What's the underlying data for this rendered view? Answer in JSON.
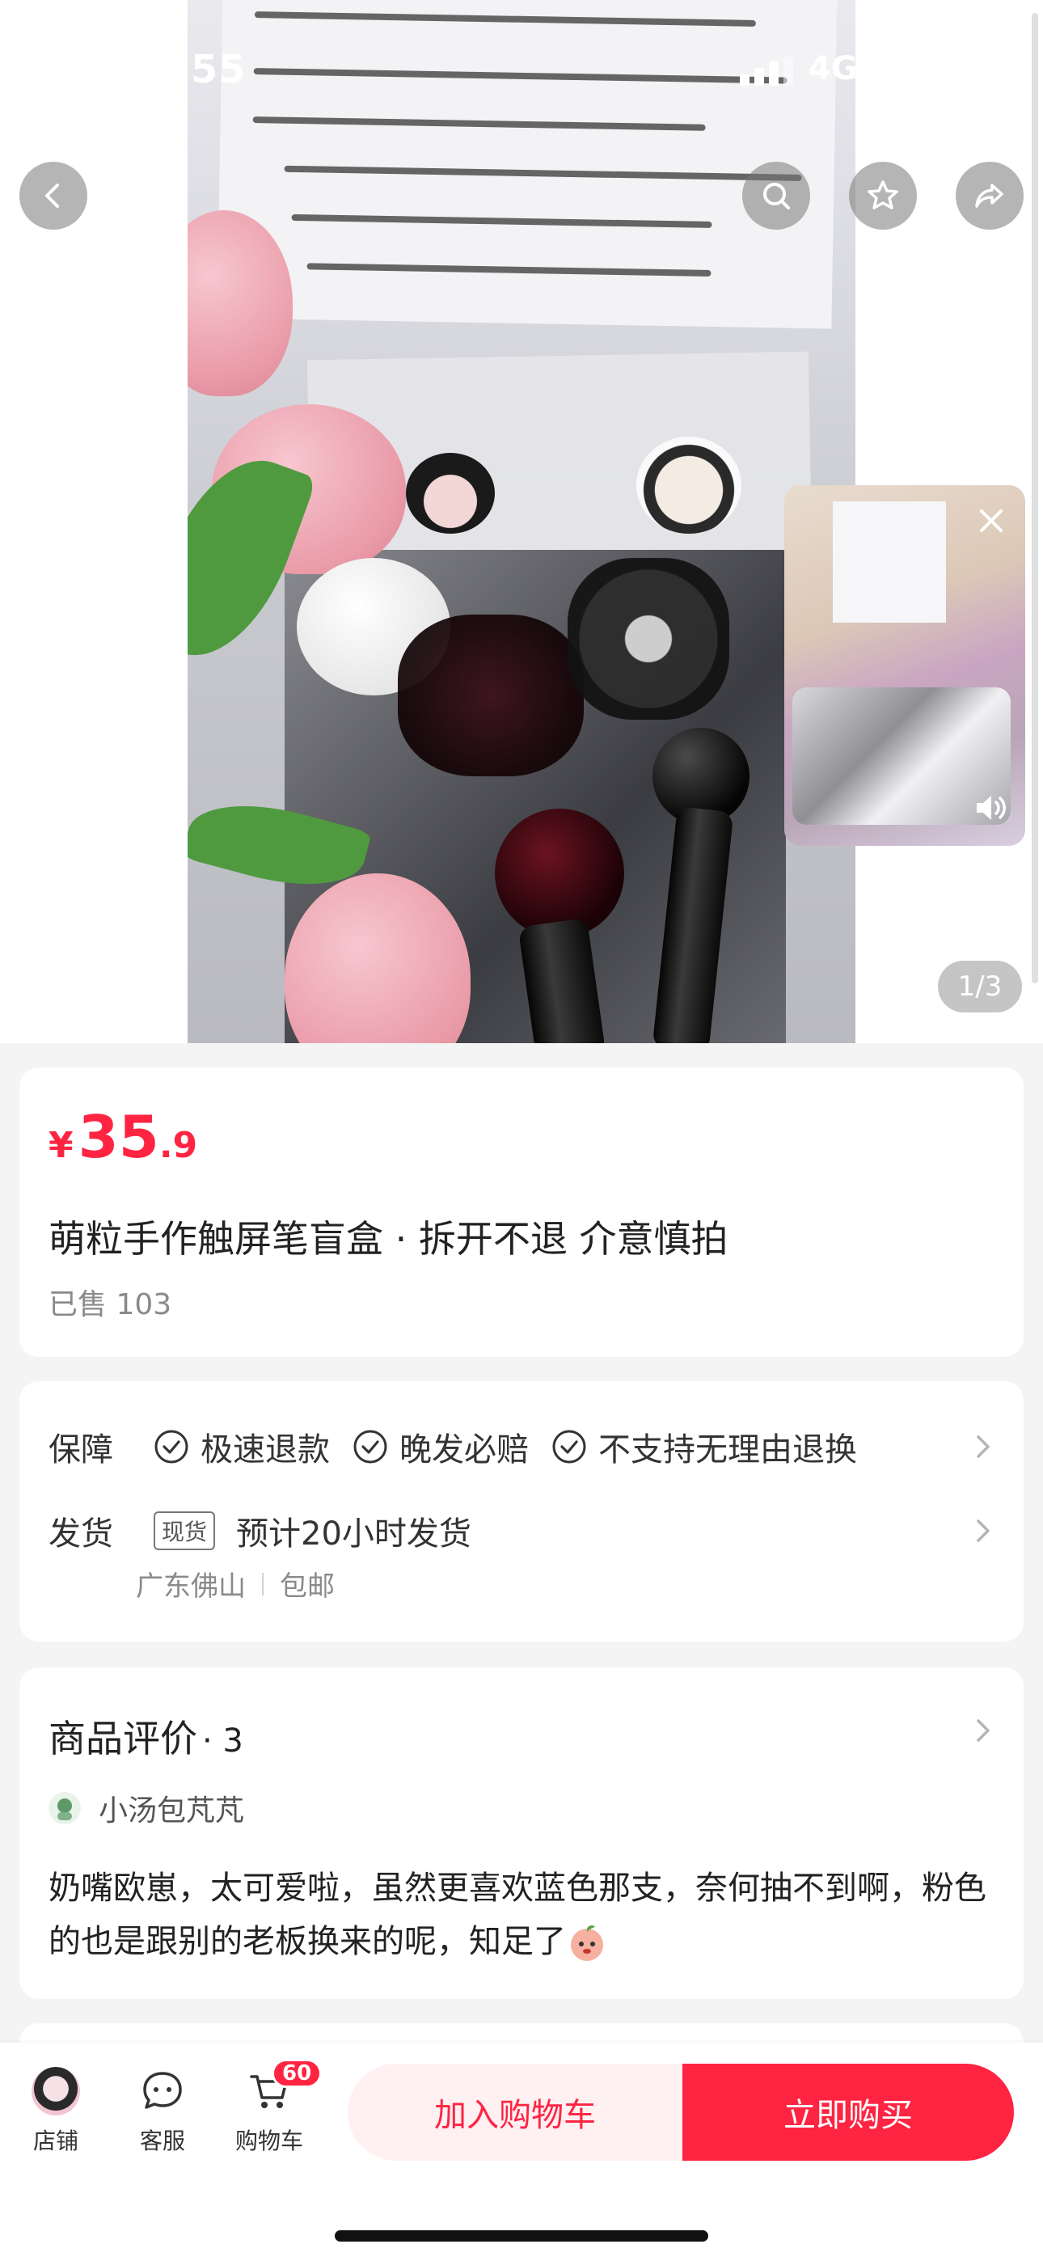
{
  "status_bar": {
    "time": "55",
    "network": "4G"
  },
  "hero": {
    "page_indicator": "1/3"
  },
  "product": {
    "currency": "¥",
    "price_int": "35",
    "price_dec": ".9",
    "title": "萌粒手作触屏笔盲盒 · 拆开不退 介意慎拍",
    "sold": "已售 103"
  },
  "service": {
    "guarantee_label": "保障",
    "guarantees": [
      "极速退款",
      "晚发必赔",
      "不支持无理由退换"
    ],
    "shipping_label": "发货",
    "stock_tag": "现货",
    "shipping_eta": "预计20小时发货",
    "origin": "广东佛山",
    "postage": "包邮"
  },
  "reviews": {
    "title": "商品评价",
    "count": "· 3",
    "reviewer": "小汤包芃芃",
    "text": "奶嘴欧崽，太可爱啦，虽然更喜欢蓝色那支，奈何抽不到啊，粉色的也是跟别的老板换来的呢，知足了"
  },
  "bottom_bar": {
    "store_label": "店铺",
    "service_label": "客服",
    "cart_label": "购物车",
    "cart_badge": "60",
    "add_to_cart": "加入购物车",
    "buy_now": "立即购买"
  },
  "colors": {
    "accent": "#ff2442",
    "accent_light": "#fff0f2",
    "background": "#f4f4f4"
  }
}
